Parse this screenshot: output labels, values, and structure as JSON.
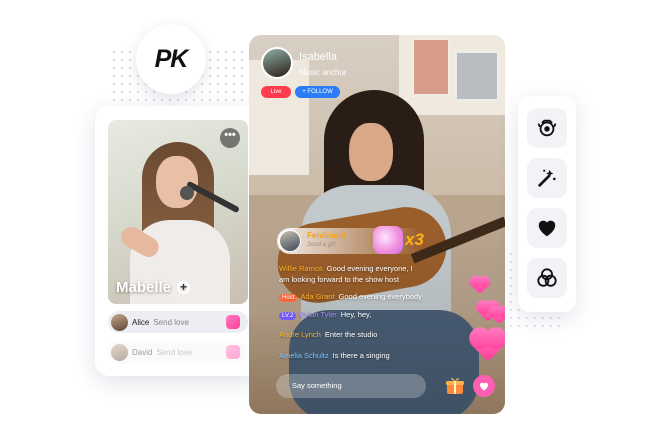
{
  "badge": {
    "label": "PK"
  },
  "left_card": {
    "name": "Mabelle",
    "rows": [
      {
        "user": "Alice",
        "message": "Send love",
        "count": "x4"
      },
      {
        "user": "David",
        "message": "Send love",
        "count": "x4"
      }
    ]
  },
  "live": {
    "host_name": "Isabella",
    "host_title": "Music anchor",
    "live_label": "Live",
    "follow_label": "+ FOLLOW",
    "combo": {
      "name": "Ferdinand",
      "subtitle": "Send a gift",
      "count": "x3"
    },
    "chat": [
      {
        "name": "Willie Ramos",
        "text": "Good evening everyone, I",
        "name_color": "#ffb52b"
      },
      {
        "name": "",
        "text": "am looking forward to the  show host",
        "name_color": "#ffffff"
      },
      {
        "badge": "Host",
        "badge_color": "#ff6b3d",
        "name": "Ada Grant",
        "text": "Good evening everybody",
        "name_color": "#ffb52b"
      },
      {
        "badge": "LV.2",
        "badge_color": "#7a5cff",
        "name": "Dylan Tyler",
        "text": "Hey, hey,",
        "name_color": "#a98bff"
      },
      {
        "name": "Andre Lynch",
        "text": "Enter the studio",
        "name_color": "#ffb52b"
      },
      {
        "name": "Amelia Schultz",
        "text": "Is there a singing",
        "name_color": "#7cc7ff"
      }
    ],
    "input_placeholder": "Say something"
  },
  "toolbar": {
    "items": [
      {
        "icon": "beauty-camera-icon"
      },
      {
        "icon": "magic-wand-icon"
      },
      {
        "icon": "heart-icon"
      },
      {
        "icon": "filter-circles-icon"
      }
    ]
  }
}
